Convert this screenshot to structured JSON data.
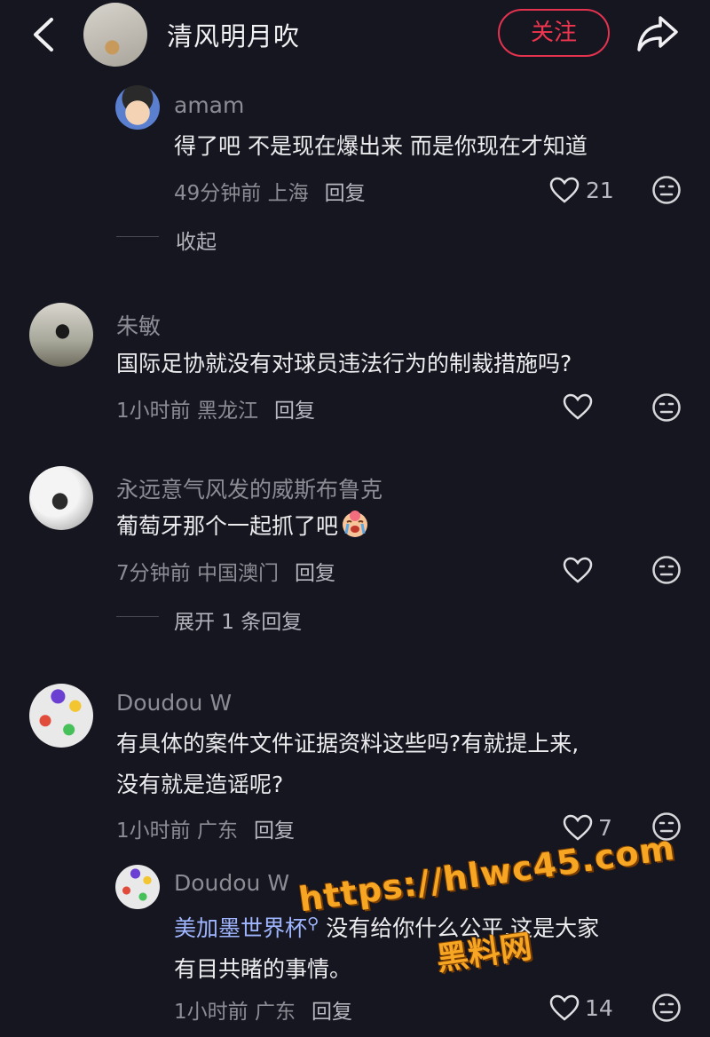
{
  "header": {
    "title": "清风明月吹",
    "follow_label": "关注"
  },
  "comments": [
    {
      "name": "amam",
      "text": "得了吧 不是现在爆出来 而是你现在才知道",
      "time_location": "49分钟前 上海",
      "reply_label": "回复",
      "likes": "21"
    },
    {
      "name": "朱敏",
      "text": "国际足协就没有对球员违法行为的制裁措施吗?",
      "time_location": "1小时前 黑龙江",
      "reply_label": "回复",
      "likes": ""
    },
    {
      "name": "永远意气风发的威斯布鲁克",
      "text": "葡萄牙那个一起抓了吧",
      "time_location": "7分钟前 中国澳门",
      "reply_label": "回复",
      "likes": ""
    },
    {
      "name": "Doudou W",
      "text_line1": "有具体的案件文件证据资料这些吗?有就提上来,",
      "text_line2": "没有就是造谣呢?",
      "time_location": "1小时前 广东",
      "reply_label": "回复",
      "likes": "7"
    },
    {
      "name": "Doudou W",
      "text_line1": "美加墨世界杯",
      "text_line1_rest": "没有给你什么公平,这是大家",
      "text_line2": "有目共睹的事情。",
      "time_location": "1小时前 广东",
      "reply_label": "回复",
      "likes": "14"
    }
  ],
  "fold": {
    "collapse_label": "收起",
    "expand_label": "展开 1 条回复"
  },
  "watermark": {
    "url": "https://hlwc45.com",
    "site": "黑料网"
  },
  "colors": {
    "background": "#161620",
    "accent": "#e5334f",
    "watermark": "#f6a623"
  }
}
